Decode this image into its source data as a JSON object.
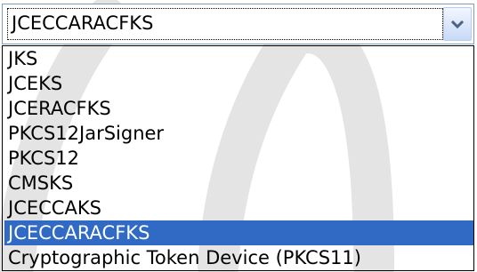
{
  "select": {
    "value": "JCECCARACFKS",
    "arrow_icon": "chevron-down-icon"
  },
  "options": [
    {
      "label": "JKS",
      "selected": false
    },
    {
      "label": "JCEKS",
      "selected": false
    },
    {
      "label": "JCERACFKS",
      "selected": false
    },
    {
      "label": "PKCS12JarSigner",
      "selected": false
    },
    {
      "label": "PKCS12",
      "selected": false
    },
    {
      "label": "CMSKS",
      "selected": false
    },
    {
      "label": "JCECCAKS",
      "selected": false
    },
    {
      "label": "JCECCARACFKS",
      "selected": true
    },
    {
      "label": "Cryptographic Token Device (PKCS11)",
      "selected": false
    }
  ],
  "colors": {
    "highlight": "#316ac5",
    "border": "#7f9db9",
    "watermark": "#e4e4e4"
  }
}
